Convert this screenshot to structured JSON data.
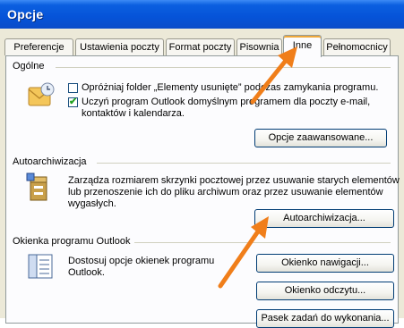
{
  "window": {
    "title": "Opcje"
  },
  "tabs": [
    {
      "label": "Preferencje",
      "active": false
    },
    {
      "label": "Ustawienia poczty",
      "active": false
    },
    {
      "label": "Format poczty",
      "active": false
    },
    {
      "label": "Pisownia",
      "active": false
    },
    {
      "label": "Inne",
      "active": true
    },
    {
      "label": "Pełnomocnicy",
      "active": false
    }
  ],
  "ogolne": {
    "label": "Ogólne",
    "empty_deleted_label": "Opróżniaj folder „Elementy usunięte” podczas zamykania programu.",
    "empty_deleted_checked": false,
    "default_program_label_1": "Uczyń program Outlook domyślnym programem dla poczty e-mail,",
    "default_program_label_2": "kontaktów i kalendarza.",
    "default_program_checked": true,
    "advanced_button": "Opcje zaawansowane..."
  },
  "autoarchive": {
    "label": "Autoarchiwizacja",
    "desc_1": "Zarządza rozmiarem skrzynki pocztowej przez usuwanie starych elementów",
    "desc_2": "lub przenoszenie ich do pliku archiwum oraz przez usuwanie elementów",
    "desc_3": "wygasłych.",
    "button": "Autoarchiwizacja..."
  },
  "outlook_panes": {
    "label": "Okienka programu Outlook",
    "desc_1": "Dostosuj opcje okienek programu",
    "desc_2": "Outlook.",
    "nav_button": "Okienko nawigacji...",
    "reading_button": "Okienko odczytu...",
    "todo_button": "Pasek zadań do wykonania..."
  },
  "colors": {
    "arrow": "#f07e1a",
    "titlebar": "#0553d8",
    "check": "#21a121"
  },
  "check_mark": "✔"
}
